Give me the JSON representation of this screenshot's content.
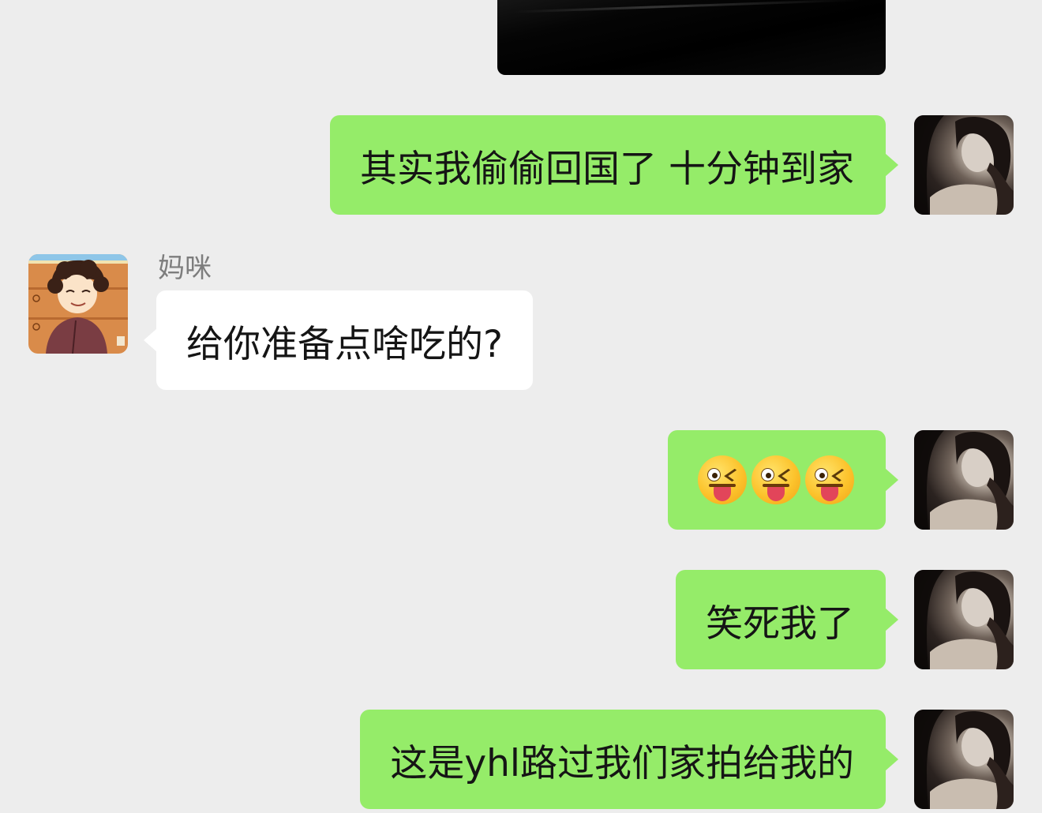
{
  "chat": {
    "contact_name": "妈咪",
    "messages": [
      {
        "id": "m1",
        "sender": "me",
        "type": "image"
      },
      {
        "id": "m2",
        "sender": "me",
        "type": "text",
        "text": "其实我偷偷回国了 十分钟到家"
      },
      {
        "id": "m3",
        "sender": "mom",
        "type": "text",
        "text": "给你准备点啥吃的?"
      },
      {
        "id": "m4",
        "sender": "me",
        "type": "emoji",
        "emojis": [
          "winking-face-with-tongue-icon",
          "winking-face-with-tongue-icon",
          "winking-face-with-tongue-icon"
        ]
      },
      {
        "id": "m5",
        "sender": "me",
        "type": "text",
        "text": "笑死我了"
      },
      {
        "id": "m6",
        "sender": "me",
        "type": "text",
        "text": "这是yhl路过我们家拍给我的"
      }
    ]
  },
  "colors": {
    "background": "#ededed",
    "outgoing_bubble": "#95ec69",
    "incoming_bubble": "#ffffff",
    "sender_name": "#7d7d7d"
  }
}
